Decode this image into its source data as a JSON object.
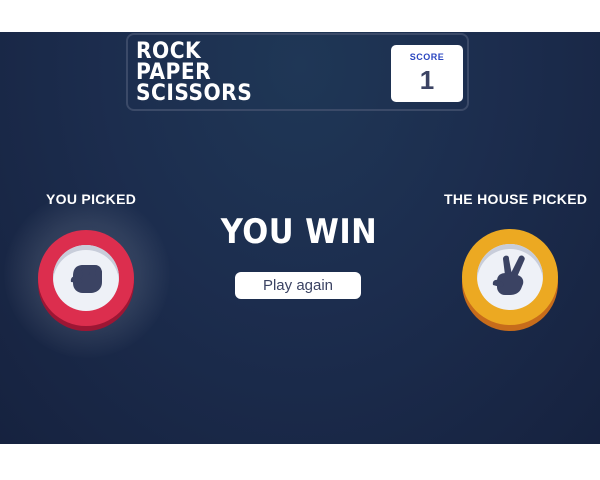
{
  "header": {
    "title_lines": [
      "ROCK",
      "PAPER",
      "SCISSORS"
    ],
    "score_label": "SCORE",
    "score_value": "1"
  },
  "player": {
    "label": "YOU PICKED",
    "choice": "rock",
    "icon": "fist-icon",
    "ring_color": "#dc2e4e"
  },
  "house": {
    "label": "THE HOUSE PICKED",
    "choice": "scissors",
    "icon": "scissors-hand-icon",
    "ring_color": "#eca922"
  },
  "result": {
    "text": "YOU WIN",
    "button_label": "Play again"
  },
  "colors": {
    "background": "#1c2d4e",
    "score_label": "#2a46c0",
    "dark_text": "#3b4363"
  }
}
